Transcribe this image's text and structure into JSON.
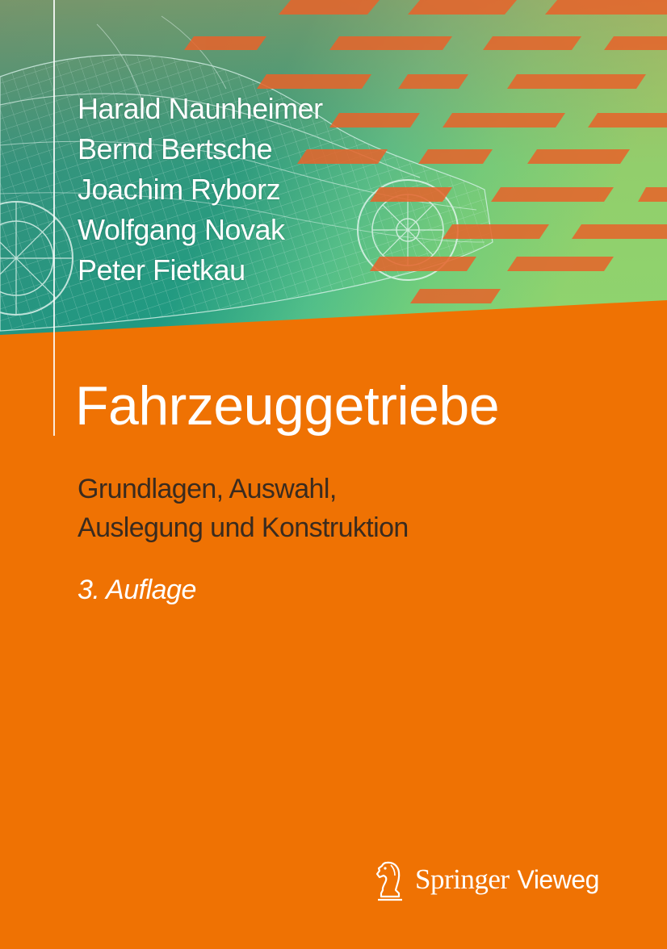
{
  "book": {
    "authors": [
      "Harald Naunheimer",
      "Bernd Bertsche",
      "Joachim Ryborz",
      "Wolfgang Novak",
      "Peter Fietkau"
    ],
    "title": "Fahrzeuggetriebe",
    "subtitle_lines": [
      "Grundlagen, Auswahl,",
      "Auslegung und Konstruktion"
    ],
    "edition": "3. Auflage",
    "publisher": {
      "name": "Springer",
      "imprint": "Vieweg",
      "logo_icon": "chess-knight-logo-icon"
    }
  },
  "colors": {
    "background_orange": "#ef7203",
    "image_teal": "#1c8c7e",
    "image_green": "#7fd47a",
    "stripe_orange": "#e8632a",
    "subtitle_text": "#3a2b1f",
    "text_white": "#ffffff"
  }
}
